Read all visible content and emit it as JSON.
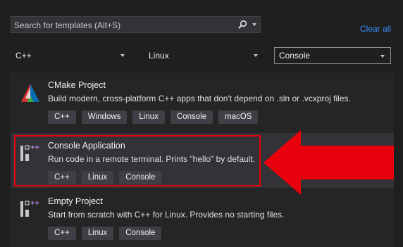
{
  "search": {
    "placeholder": "Search for templates (Alt+S)"
  },
  "clear_all_label": "Clear all",
  "filters": {
    "language": "C++",
    "platform": "Linux",
    "project_type": "Console"
  },
  "templates": [
    {
      "title": "CMake Project",
      "description": "Build modern, cross-platform C++ apps that don't depend on .sln or .vcxproj files.",
      "tags": [
        "C++",
        "Windows",
        "Linux",
        "Console",
        "macOS"
      ],
      "icon": "cmake-icon"
    },
    {
      "title": "Console Application",
      "description": "Run code in a remote terminal. Prints \"hello\" by default.",
      "tags": [
        "C++",
        "Linux",
        "Console"
      ],
      "icon": "console-app-icon"
    },
    {
      "title": "Empty Project",
      "description": "Start from scratch with C++ for Linux. Provides no starting files.",
      "tags": [
        "C++",
        "Linux",
        "Console"
      ],
      "icon": "empty-project-icon"
    }
  ],
  "colors": {
    "highlight": "#e8000d",
    "link": "#3794ff",
    "background": "#1f1f1f"
  }
}
